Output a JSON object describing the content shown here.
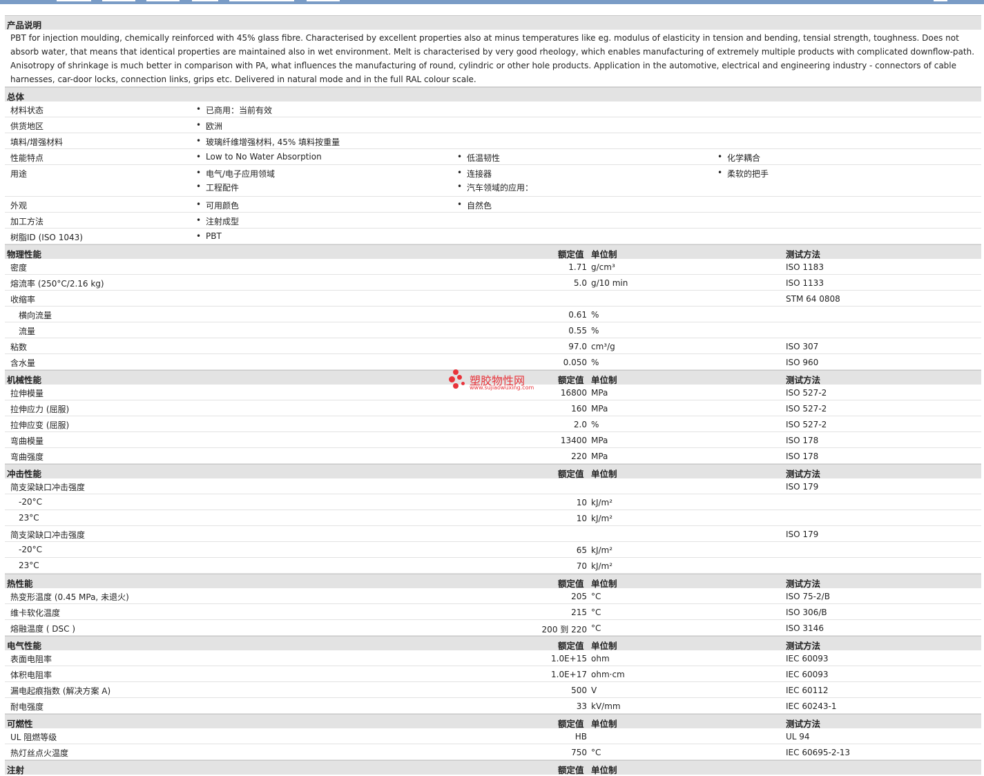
{
  "description": {
    "title": "产品说明",
    "text": "PBT for injection moulding, chemically reinforced with 45% glass fibre. Characterised by excellent properties also at minus temperatures like eg. modulus of elasticity in tension and bending, tensial strength, toughness. Does not absorb water, that means that identical properties are maintained also in wet environment. Melt is characterised by very good rheology, which enables manufacturing of extremely multiple products with complicated downflow-path. Anisotropy of shrinkage is much better in comparison with PA, what influences the manufacturing of round, cylindric or other hole products. Application in the automotive, electrical and engineering industry - connectors of cable harnesses, car-door locks, connection links, grips etc. Delivered in natural mode and in the full RAL colour scale."
  },
  "general": {
    "title": "总体",
    "rows": [
      {
        "label": "材料状态",
        "items": [
          "已商用：当前有效"
        ]
      },
      {
        "label": "供货地区",
        "items": [
          "欧洲"
        ]
      },
      {
        "label": "填料/增强材料",
        "items": [
          "玻璃纤维增强材料, 45% 填料按重量"
        ]
      },
      {
        "label": "性能特点",
        "items": [
          "Low to No Water Absorption",
          "低温韧性",
          "化学耦合"
        ]
      },
      {
        "label": "用途",
        "items": [
          "电气/电子应用领域",
          "连接器",
          "柔软的把手",
          "工程配件",
          "汽车领域的应用："
        ]
      },
      {
        "label": "外观",
        "items": [
          "可用颜色",
          "自然色"
        ]
      },
      {
        "label": "加工方法",
        "items": [
          "注射成型"
        ]
      },
      {
        "label": "树脂ID (ISO 1043)",
        "items": [
          "PBT"
        ]
      }
    ]
  },
  "headers": {
    "value": "额定值",
    "unit": "单位制",
    "method": "测试方法"
  },
  "physical": {
    "title": "物理性能",
    "rows": [
      {
        "label": "密度",
        "value": "1.71",
        "unit": "g/cm³",
        "method": "ISO 1183"
      },
      {
        "label": "熔流率 (250°C/2.16 kg)",
        "value": "5.0",
        "unit": "g/10 min",
        "method": "ISO 1133"
      },
      {
        "label": "收缩率",
        "value": "",
        "unit": "",
        "method": "STM 64 0808"
      },
      {
        "label": "横向流量",
        "value": "0.61",
        "unit": "%",
        "method": "",
        "sub": true
      },
      {
        "label": "流量",
        "value": "0.55",
        "unit": "%",
        "method": "",
        "sub": true
      },
      {
        "label": "粘数",
        "value": "97.0",
        "unit": "cm³/g",
        "method": "ISO 307"
      },
      {
        "label": "含水量",
        "value": "0.050",
        "unit": "%",
        "method": "ISO 960"
      }
    ]
  },
  "mechanical": {
    "title": "机械性能",
    "rows": [
      {
        "label": "拉伸模量",
        "value": "16800",
        "unit": "MPa",
        "method": "ISO 527-2"
      },
      {
        "label": "拉伸应力 (屈服)",
        "value": "160",
        "unit": "MPa",
        "method": "ISO 527-2"
      },
      {
        "label": "拉伸应变 (屈服)",
        "value": "2.0",
        "unit": "%",
        "method": "ISO 527-2"
      },
      {
        "label": "弯曲模量",
        "value": "13400",
        "unit": "MPa",
        "method": "ISO 178"
      },
      {
        "label": "弯曲强度",
        "value": "220",
        "unit": "MPa",
        "method": "ISO 178"
      }
    ]
  },
  "impact": {
    "title": "冲击性能",
    "rows": [
      {
        "label": "简支梁缺口冲击强度",
        "value": "",
        "unit": "",
        "method": "ISO 179"
      },
      {
        "label": "-20°C",
        "value": "10",
        "unit": "kJ/m²",
        "method": "",
        "sub": true
      },
      {
        "label": "23°C",
        "value": "10",
        "unit": "kJ/m²",
        "method": "",
        "sub": true
      },
      {
        "label": "简支梁缺口冲击强度",
        "value": "",
        "unit": "",
        "method": "ISO 179"
      },
      {
        "label": "-20°C",
        "value": "65",
        "unit": "kJ/m²",
        "method": "",
        "sub": true
      },
      {
        "label": "23°C",
        "value": "70",
        "unit": "kJ/m²",
        "method": "",
        "sub": true
      }
    ]
  },
  "thermal": {
    "title": "热性能",
    "rows": [
      {
        "label": "热变形温度 (0.45 MPa, 未退火)",
        "value": "205",
        "unit": "°C",
        "method": "ISO 75-2/B"
      },
      {
        "label": "维卡软化温度",
        "value": "215",
        "unit": "°C",
        "method": "ISO 306/B"
      },
      {
        "label": "熔融温度 ( DSC )",
        "value": "200 到 220",
        "unit": "°C",
        "method": "ISO 3146"
      }
    ]
  },
  "electrical": {
    "title": "电气性能",
    "rows": [
      {
        "label": "表面电阻率",
        "value": "1.0E+15",
        "unit": "ohm",
        "method": "IEC 60093"
      },
      {
        "label": "体积电阻率",
        "value": "1.0E+17",
        "unit": "ohm·cm",
        "method": "IEC 60093"
      },
      {
        "label": "漏电起痕指数 (解决方案 A)",
        "value": "500",
        "unit": "V",
        "method": "IEC 60112"
      },
      {
        "label": "耐电强度",
        "value": "33",
        "unit": "kV/mm",
        "method": "IEC 60243-1"
      }
    ]
  },
  "flammability": {
    "title": "可燃性",
    "rows": [
      {
        "label": "UL 阻燃等级",
        "value": "HB",
        "unit": "",
        "method": "UL 94"
      },
      {
        "label": "热灯丝点火温度",
        "value": "750",
        "unit": "°C",
        "method": "IEC 60695-2-13"
      }
    ]
  },
  "injection": {
    "title": "注射"
  },
  "watermark": {
    "name": "塑胶物性网",
    "url": "www.sujiaowuxing.com",
    "color": "#e8333a"
  }
}
